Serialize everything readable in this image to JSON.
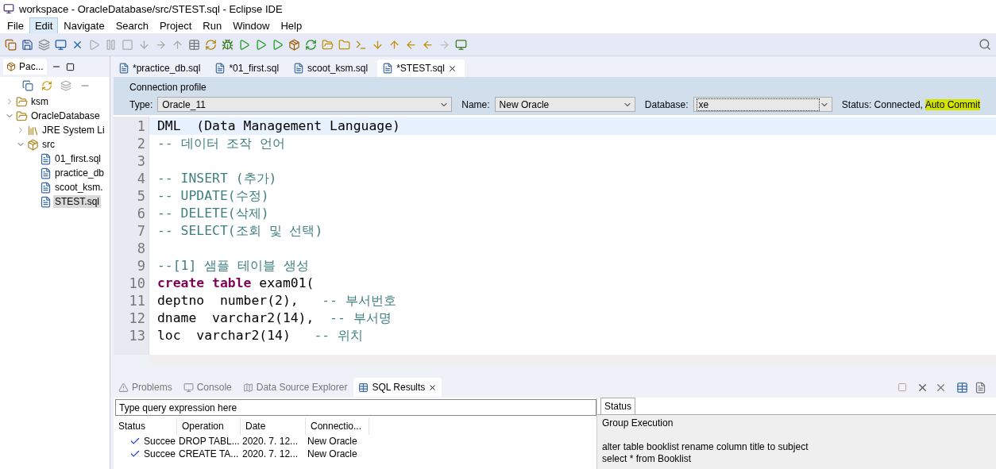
{
  "window": {
    "title": "workspace - OracleDatabase/src/STEST.sql - Eclipse IDE"
  },
  "menu": [
    {
      "label": "File",
      "selected": false
    },
    {
      "label": "Edit",
      "selected": true
    },
    {
      "label": "Navigate",
      "selected": false
    },
    {
      "label": "Search",
      "selected": false
    },
    {
      "label": "Project",
      "selected": false
    },
    {
      "label": "Run",
      "selected": false
    },
    {
      "label": "Window",
      "selected": false
    },
    {
      "label": "Help",
      "selected": false
    }
  ],
  "explorer": {
    "tab": "Pac...",
    "tree": [
      {
        "label": "ksm",
        "kind": "project",
        "expanded": false,
        "selected": false
      },
      {
        "label": "OracleDatabase",
        "kind": "project",
        "expanded": true,
        "selected": false,
        "children": [
          {
            "label": "JRE System Li",
            "kind": "library",
            "expanded": false,
            "selected": false
          },
          {
            "label": "src",
            "kind": "package",
            "expanded": true,
            "selected": false,
            "children": [
              {
                "label": "01_first.sql",
                "kind": "file",
                "selected": false
              },
              {
                "label": "practice_db",
                "kind": "file",
                "selected": false
              },
              {
                "label": "scoot_ksm.",
                "kind": "file",
                "selected": false
              },
              {
                "label": "STEST.sql",
                "kind": "file",
                "selected": true
              }
            ]
          }
        ]
      }
    ]
  },
  "editor_tabs": [
    {
      "label": "*practice_db.sql",
      "selected": false
    },
    {
      "label": "*01_first.sql",
      "selected": false
    },
    {
      "label": "scoot_ksm.sql",
      "selected": false
    },
    {
      "label": "*STEST.sql",
      "selected": true
    }
  ],
  "connection": {
    "title": "Connection profile",
    "type": {
      "label": "Type:",
      "value": "Oracle_11"
    },
    "name": {
      "label": "Name:",
      "value": "New Oracle"
    },
    "database": {
      "label": "Database:",
      "value": "xe"
    },
    "status": {
      "label": "Status:",
      "value": "Connected,",
      "highlight": "Auto Commit"
    }
  },
  "editor": {
    "lines": [
      {
        "number": "1",
        "current": true,
        "segments": [
          {
            "kind": "plain",
            "text": "DML  (Data Management Language)"
          }
        ]
      },
      {
        "number": "2",
        "current": false,
        "segments": [
          {
            "kind": "comment",
            "text": "-- 데이터 조작 언어"
          }
        ]
      },
      {
        "number": "3",
        "current": false
      },
      {
        "number": "4",
        "current": false,
        "segments": [
          {
            "kind": "comment",
            "text": "-- INSERT (추가)"
          }
        ]
      },
      {
        "number": "5",
        "current": false,
        "segments": [
          {
            "kind": "comment",
            "text": "-- UPDATE(수정)"
          }
        ]
      },
      {
        "number": "6",
        "current": false,
        "segments": [
          {
            "kind": "comment",
            "text": "-- DELETE(삭제)"
          }
        ]
      },
      {
        "number": "7",
        "current": false,
        "segments": [
          {
            "kind": "comment",
            "text": "-- SELECT(조회 및 선택)"
          }
        ]
      },
      {
        "number": "8",
        "current": false
      },
      {
        "number": "9",
        "current": false,
        "segments": [
          {
            "kind": "comment",
            "text": "--[1] 샘플 테이블 생성"
          }
        ]
      },
      {
        "number": "10",
        "current": false,
        "segments": [
          {
            "kind": "keyword",
            "text": "create table"
          },
          {
            "kind": "plain",
            "text": " exam01("
          }
        ]
      },
      {
        "number": "11",
        "current": false,
        "segments": [
          {
            "kind": "plain",
            "text": "deptno  number(2),   "
          },
          {
            "kind": "comment",
            "text": "-- 부서번호"
          }
        ]
      },
      {
        "number": "12",
        "current": false,
        "segments": [
          {
            "kind": "plain",
            "text": "dname  varchar2(14),  "
          },
          {
            "kind": "comment",
            "text": "-- 부서명"
          }
        ]
      },
      {
        "number": "13",
        "current": false,
        "segments": [
          {
            "kind": "plain",
            "text": "loc  varchar2(14)   "
          },
          {
            "kind": "comment",
            "text": "-- 위치"
          }
        ]
      }
    ]
  },
  "bottom_tabs": [
    {
      "label": "Problems",
      "selected": false
    },
    {
      "label": "Console",
      "selected": false
    },
    {
      "label": "Data Source Explorer",
      "selected": false
    },
    {
      "label": "SQL Results",
      "selected": true
    }
  ],
  "results": {
    "filter": {
      "placeholder": "Type query expression here"
    },
    "columns": [
      "Status",
      "Operation",
      "Date",
      "Connectio..."
    ],
    "rows": [
      {
        "status": "Succee",
        "operation": "DROP TABL...",
        "date": "2020. 7. 12...",
        "connection": "New Oracle"
      },
      {
        "status": "Succee",
        "operation": "CREATE TA...",
        "date": "2020. 7. 12...",
        "connection": "New Oracle"
      }
    ]
  },
  "status_pane": {
    "tab": "Status",
    "paragraphs": [
      [
        "Group Execution"
      ],
      [
        "alter table booklist rename column title to subject",
        "select * from Booklist"
      ]
    ]
  }
}
